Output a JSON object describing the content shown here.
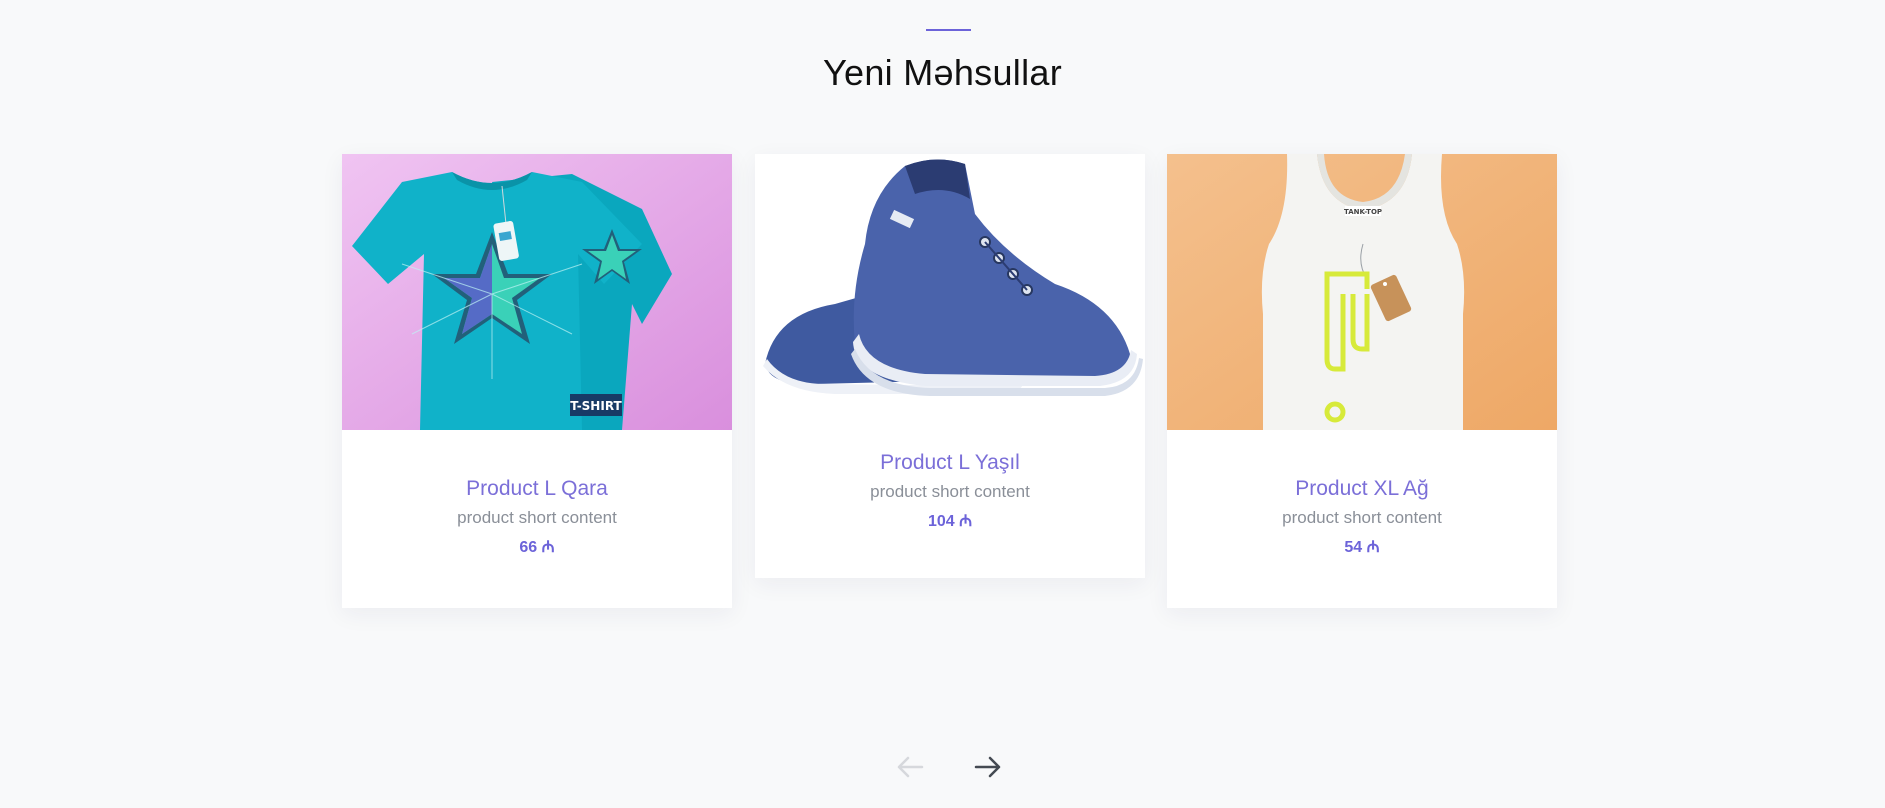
{
  "section": {
    "title": "Yeni Məhsullar"
  },
  "products": [
    {
      "name": "Product L Qara",
      "description": "product short content",
      "price": "66 ₼",
      "image_icon": "tshirt-image"
    },
    {
      "name": "Product L Yaşıl",
      "description": "product short content",
      "price": "104 ₼",
      "image_icon": "sneaker-image"
    },
    {
      "name": "Product XL Ağ",
      "description": "product short content",
      "price": "54 ₼",
      "image_icon": "tank-top-image"
    }
  ],
  "images": {
    "tshirt_tag_text": "T-SHIRT",
    "tank_top_tag_text": "TANK-TOP"
  },
  "navigation": {
    "prev_icon": "arrow-left-icon",
    "next_icon": "arrow-right-icon",
    "prev_disabled": true
  },
  "colors": {
    "accent": "#6c63d9",
    "name": "#7b6fd8",
    "muted": "#8a8f98",
    "background": "#f8f9fa"
  }
}
